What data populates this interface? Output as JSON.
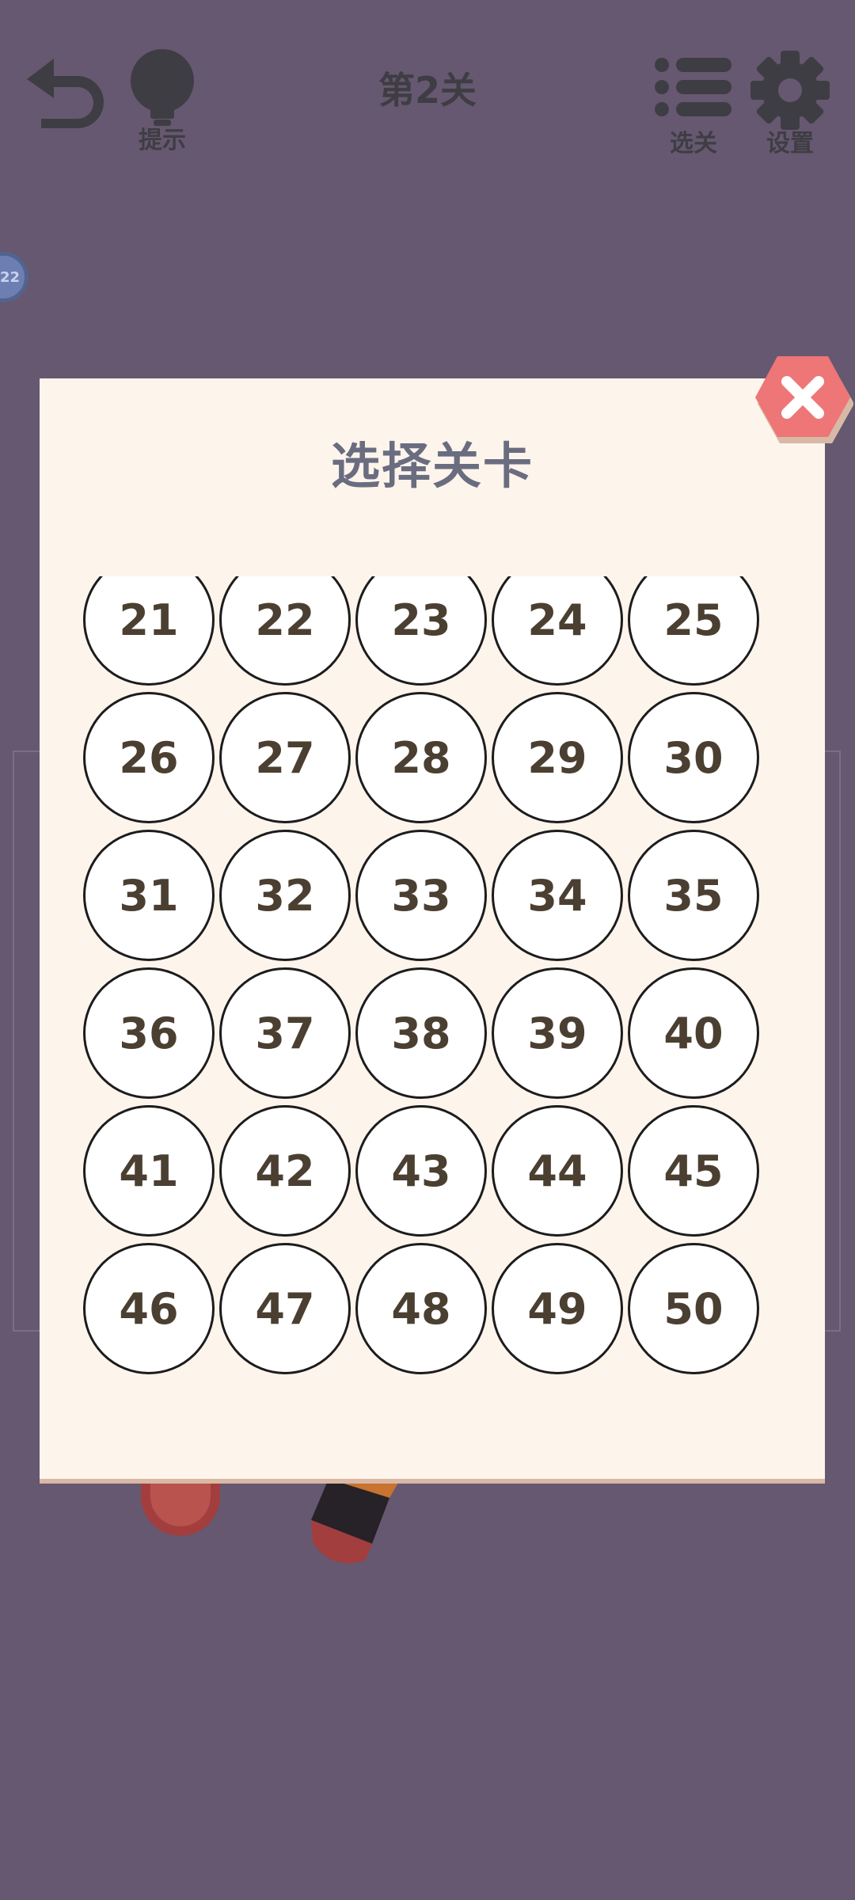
{
  "topbar": {
    "level_title": "第2关",
    "hint_label": "提示",
    "select_label": "选关",
    "settings_label": "设置"
  },
  "background": {
    "side_badge_text": "22"
  },
  "dialog": {
    "title": "选择关卡",
    "levels": [
      "21",
      "22",
      "23",
      "24",
      "25",
      "26",
      "27",
      "28",
      "29",
      "30",
      "31",
      "32",
      "33",
      "34",
      "35",
      "36",
      "37",
      "38",
      "39",
      "40",
      "41",
      "42",
      "43",
      "44",
      "45",
      "46",
      "47",
      "48",
      "49",
      "50"
    ]
  },
  "colors": {
    "background": "#665870",
    "panel": "#fdf4ec",
    "close_button": "#ee7677",
    "number_text": "#4b3f31",
    "icon_dark": "#3f3d44"
  }
}
